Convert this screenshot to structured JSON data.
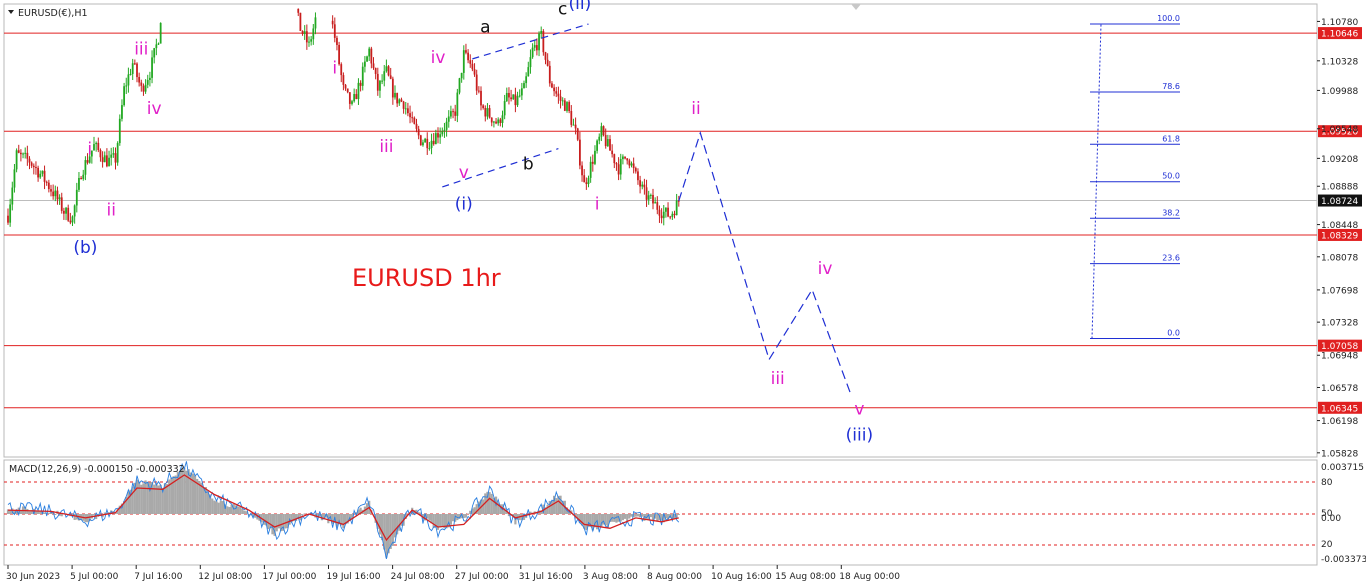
{
  "window": {
    "title": "EURUSD(€),H1"
  },
  "macd_panel": {
    "title": "MACD(12,26,9) -0.000150 -0.000332",
    "axis_labels": [
      "0.003715",
      "80",
      "50",
      "0.00",
      "20",
      "-0.003373"
    ]
  },
  "chart_data": {
    "type": "line",
    "title": "EURUSD 1hr",
    "symbol": "EURUSD",
    "timeframe": "H1",
    "y_axis_ticks": [
      1.1078,
      1.10328,
      1.09988,
      1.09548,
      1.09208,
      1.08888,
      1.08448,
      1.08078,
      1.07698,
      1.07328,
      1.06948,
      1.06578,
      1.06198,
      1.05828
    ],
    "ylim": [
      1.0578,
      1.1098
    ],
    "x_axis_labels": [
      "30 Jun 2023",
      "5 Jul 00:00",
      "7 Jul 16:00",
      "12 Jul 08:00",
      "17 Jul 00:00",
      "19 Jul 16:00",
      "24 Jul 08:00",
      "27 Jul 00:00",
      "31 Jul 16:00",
      "3 Aug 08:00",
      "8 Aug 00:00",
      "10 Aug 16:00",
      "15 Aug 08:00",
      "18 Aug 00:00"
    ],
    "current_price": 1.08724,
    "horizontal_levels": [
      1.10646,
      1.0952,
      1.08329,
      1.07058,
      1.06345
    ],
    "fibonacci": [
      {
        "label": "100.0",
        "price": 1.1075
      },
      {
        "label": "78.6",
        "price": 1.0997
      },
      {
        "label": "61.8",
        "price": 1.0937
      },
      {
        "label": "50.0",
        "price": 1.0894
      },
      {
        "label": "38.2",
        "price": 1.0852
      },
      {
        "label": "23.6",
        "price": 1.08
      },
      {
        "label": "0.0",
        "price": 1.0714
      }
    ],
    "price_path": [
      [
        0,
        1.0855
      ],
      [
        2,
        1.0925
      ],
      [
        5,
        1.0918
      ],
      [
        8,
        1.09
      ],
      [
        11,
        1.0878
      ],
      [
        13,
        1.086
      ],
      [
        15,
        1.0852
      ],
      [
        17,
        1.0905
      ],
      [
        20,
        1.0935
      ],
      [
        23,
        1.0918
      ],
      [
        25,
        1.092
      ],
      [
        27,
        1.1
      ],
      [
        29,
        1.103
      ],
      [
        31,
        1.1
      ],
      [
        33,
        1.102
      ],
      [
        35,
        1.106
      ],
      [
        37,
        1.115
      ],
      [
        39,
        1.12
      ]
    ],
    "price_path_2": [
      [
        66,
        1.111
      ],
      [
        68,
        1.107
      ],
      [
        70,
        1.105
      ],
      [
        72,
        1.109
      ],
      [
        74,
        1.111
      ],
      [
        76,
        1.106
      ],
      [
        78,
        1.1
      ],
      [
        80,
        1.098
      ],
      [
        82,
        1.101
      ],
      [
        84,
        1.1045
      ],
      [
        86,
        1.1
      ],
      [
        88,
        1.102
      ],
      [
        90,
        1.099
      ],
      [
        92,
        1.0985
      ],
      [
        94,
        1.096
      ],
      [
        96,
        1.0942
      ],
      [
        98,
        1.094
      ],
      [
        100,
        1.095
      ],
      [
        102,
        1.096
      ],
      [
        104,
        1.0975
      ],
      [
        106,
        1.104
      ],
      [
        108,
        1.1025
      ],
      [
        110,
        1.098
      ],
      [
        112,
        1.097
      ],
      [
        114,
        1.096
      ],
      [
        116,
        1.099
      ],
      [
        118,
        1.0985
      ],
      [
        120,
        1.1
      ],
      [
        122,
        1.1045
      ],
      [
        124,
        1.106
      ],
      [
        126,
        1.101
      ],
      [
        128,
        1.099
      ],
      [
        130,
        1.098
      ],
      [
        132,
        1.095
      ],
      [
        134,
        1.089
      ],
      [
        136,
        1.092
      ],
      [
        138,
        1.095
      ],
      [
        140,
        1.093
      ],
      [
        142,
        1.091
      ],
      [
        144,
        1.0925
      ],
      [
        146,
        1.09
      ],
      [
        148,
        1.088
      ],
      [
        150,
        1.087
      ],
      [
        152,
        1.086
      ],
      [
        154,
        1.0855
      ],
      [
        156,
        1.0872
      ]
    ],
    "projection": [
      [
        156,
        1.0872
      ],
      [
        161,
        1.095
      ],
      [
        177,
        1.069
      ],
      [
        187,
        1.077
      ],
      [
        196,
        1.065
      ]
    ],
    "wave_labels": [
      {
        "text": "(b)",
        "x": 18,
        "price": 1.0812,
        "color": "#1f2fd4",
        "size": 17
      },
      {
        "text": "i",
        "x": 19,
        "price": 1.0925,
        "color": "#e020c8",
        "size": 17
      },
      {
        "text": "ii",
        "x": 24,
        "price": 1.0855,
        "color": "#e020c8",
        "size": 17
      },
      {
        "text": "iii",
        "x": 31,
        "price": 1.104,
        "color": "#e020c8",
        "size": 17
      },
      {
        "text": "iv",
        "x": 34,
        "price": 1.0972,
        "color": "#e020c8",
        "size": 17
      },
      {
        "text": "i",
        "x": 76,
        "price": 1.1018,
        "color": "#e020c8",
        "size": 17
      },
      {
        "text": "iii",
        "x": 88,
        "price": 1.0928,
        "color": "#e020c8",
        "size": 17
      },
      {
        "text": "iv",
        "x": 100,
        "price": 1.103,
        "color": "#e020c8",
        "size": 17
      },
      {
        "text": "v",
        "x": 106,
        "price": 1.0898,
        "color": "#e020c8",
        "size": 17
      },
      {
        "text": "(i)",
        "x": 106,
        "price": 1.0862,
        "color": "#1f2fd4",
        "size": 17
      },
      {
        "text": "a",
        "x": 111,
        "price": 1.1065,
        "color": "#111111",
        "size": 17
      },
      {
        "text": "b",
        "x": 121,
        "price": 1.0908,
        "color": "#111111",
        "size": 17
      },
      {
        "text": "c",
        "x": 129,
        "price": 1.1086,
        "color": "#111111",
        "size": 17
      },
      {
        "text": "(ii)",
        "x": 133,
        "price": 1.1092,
        "color": "#1f2fd4",
        "size": 17
      },
      {
        "text": "i",
        "x": 137,
        "price": 1.0862,
        "color": "#e020c8",
        "size": 17
      },
      {
        "text": "ii",
        "x": 160,
        "price": 1.0972,
        "color": "#e020c8",
        "size": 17
      },
      {
        "text": "iii",
        "x": 179,
        "price": 1.0662,
        "color": "#e020c8",
        "size": 17
      },
      {
        "text": "iv",
        "x": 190,
        "price": 1.0788,
        "color": "#e020c8",
        "size": 17
      },
      {
        "text": "v",
        "x": 198,
        "price": 1.0627,
        "color": "#e020c8",
        "size": 17
      },
      {
        "text": "(iii)",
        "x": 198,
        "price": 1.0597,
        "color": "#1f2fd4",
        "size": 17
      }
    ],
    "trendlines": [
      {
        "from": [
          101,
          1.0888
        ],
        "to": [
          128,
          1.0932
        ]
      },
      {
        "from": [
          108,
          1.1035
        ],
        "to": [
          135,
          1.1075
        ]
      }
    ],
    "macd_signal": [
      [
        0,
        0.0003
      ],
      [
        10,
        0.0002
      ],
      [
        18,
        -0.0003
      ],
      [
        25,
        0.0001
      ],
      [
        30,
        0.002
      ],
      [
        36,
        0.0019
      ],
      [
        41,
        0.003
      ],
      [
        48,
        0.0015
      ],
      [
        56,
        0.0003
      ],
      [
        62,
        -0.001
      ],
      [
        70,
        0.0
      ],
      [
        78,
        -0.0008
      ],
      [
        84,
        0.0005
      ],
      [
        88,
        -0.002
      ],
      [
        94,
        0.0003
      ],
      [
        100,
        -0.001
      ],
      [
        106,
        -0.0008
      ],
      [
        112,
        0.0012
      ],
      [
        118,
        -0.0003
      ],
      [
        124,
        0.0002
      ],
      [
        128,
        0.001
      ],
      [
        134,
        -0.0008
      ],
      [
        140,
        -0.0011
      ],
      [
        146,
        -0.0003
      ],
      [
        152,
        -0.0006
      ],
      [
        156,
        -0.0003
      ]
    ],
    "macd_histogram": [
      [
        0,
        0.0005
      ],
      [
        10,
        0.0002
      ],
      [
        18,
        -0.0005
      ],
      [
        25,
        0.0002
      ],
      [
        30,
        0.0025
      ],
      [
        36,
        0.0022
      ],
      [
        41,
        0.0037
      ],
      [
        48,
        0.0012
      ],
      [
        56,
        0.0001
      ],
      [
        62,
        -0.0015
      ],
      [
        70,
        0.0001
      ],
      [
        78,
        -0.001
      ],
      [
        84,
        0.001
      ],
      [
        88,
        -0.0032
      ],
      [
        94,
        0.0005
      ],
      [
        100,
        -0.0012
      ],
      [
        106,
        -0.0004
      ],
      [
        112,
        0.0018
      ],
      [
        118,
        -0.0006
      ],
      [
        124,
        0.0004
      ],
      [
        128,
        0.0015
      ],
      [
        134,
        -0.0012
      ],
      [
        140,
        -0.0008
      ],
      [
        146,
        -0.0003
      ],
      [
        152,
        -0.0005
      ],
      [
        156,
        -0.0001
      ]
    ],
    "colors": {
      "bull": "#22a822",
      "bear": "#c81e1e",
      "level": "#e02020",
      "fib": "#1f2fd4",
      "projection": "#1f2fd4",
      "macd_signal": "#d42020",
      "macd_hist": "#a9a9a9",
      "title": "#e81a1a"
    }
  }
}
